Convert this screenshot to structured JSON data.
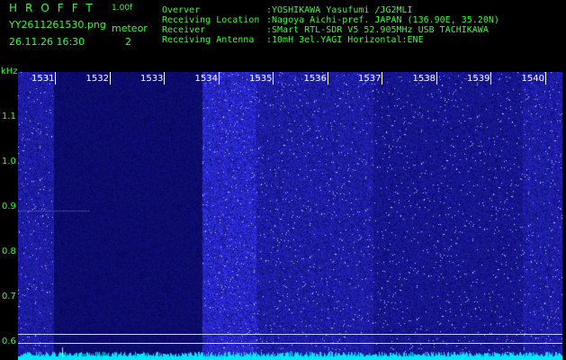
{
  "header": {
    "app_title": "HROFFT",
    "app_version": "1.00f",
    "file_name": "YY2611261530.png",
    "timestamp": "26.11.26 16:30",
    "meteor_label": "meteor",
    "meteor_count": "2"
  },
  "info": [
    {
      "key": "Overver",
      "value": ":YOSHIKAWA Yasufumi /JG2MLI"
    },
    {
      "key": "Receiving Location",
      "value": ":Nagoya Aichi-pref. JAPAN (136.90E, 35.20N)"
    },
    {
      "key": "Receiver",
      "value": ":SMart RTL-SDR V5 52.905MHz USB TACHIKAWA"
    },
    {
      "key": "Receiving Antenna",
      "value": ":10mH 3el.YAGI Horizontal:ENE"
    }
  ],
  "y_axis": {
    "unit": "kHz",
    "ticks": [
      "1.1",
      "1.0",
      "0.9",
      "0.8",
      "0.7",
      "0.6"
    ]
  },
  "x_axis": {
    "ticks": [
      "1531",
      "1532",
      "1533",
      "1534",
      "1535",
      "1536",
      "1537",
      "1538",
      "1539",
      "1540"
    ]
  },
  "colors": {
    "text": "#33ff33",
    "background": "#07075a",
    "noise": "#2b2bd8",
    "baseline": "#00e6ff"
  }
}
